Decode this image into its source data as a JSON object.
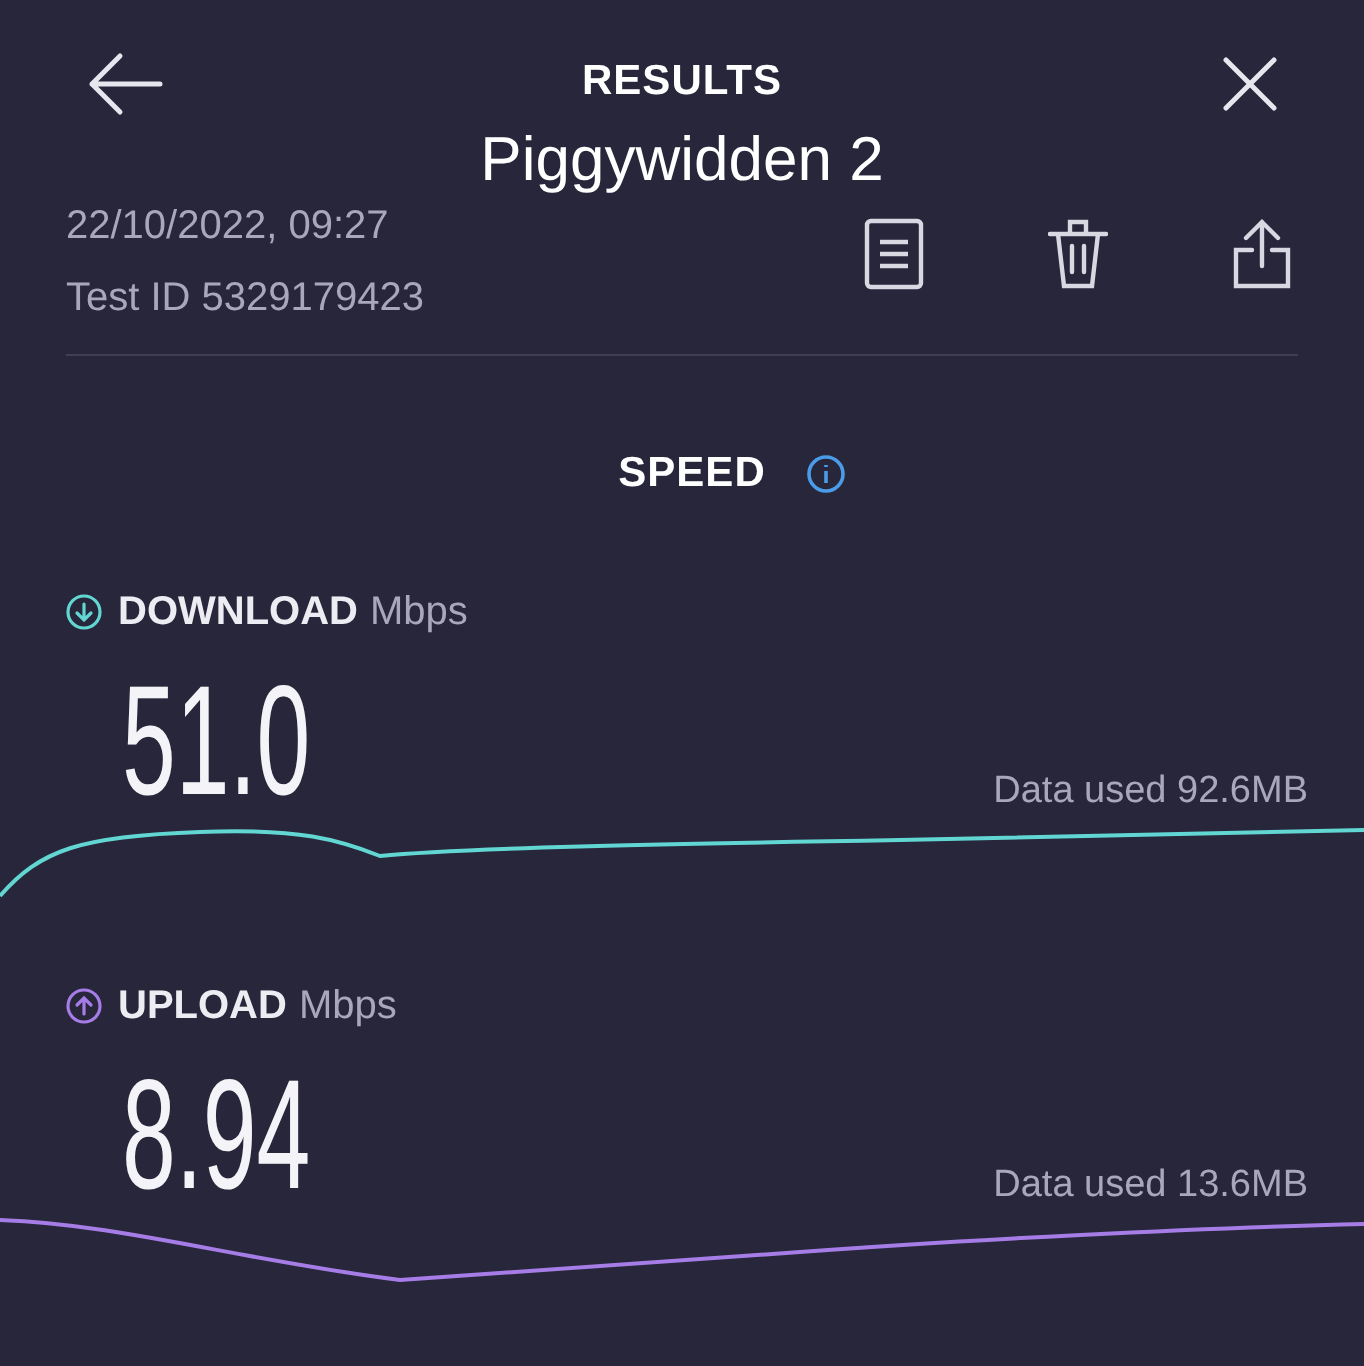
{
  "header": {
    "title": "RESULTS",
    "server": "Piggywidden 2",
    "date": "22/10/2022, 09:27",
    "test_id": "Test ID 5329179423"
  },
  "section": {
    "title": "SPEED"
  },
  "metrics": [
    {
      "kind": "download",
      "label": "DOWNLOAD",
      "unit": "Mbps",
      "value": "51.0",
      "data_used": "Data used 92.6MB",
      "color": "#62d6d2"
    },
    {
      "kind": "upload",
      "label": "UPLOAD",
      "unit": "Mbps",
      "value": "8.94",
      "data_used": "Data used 13.6MB",
      "color": "#a67ce6"
    }
  ]
}
